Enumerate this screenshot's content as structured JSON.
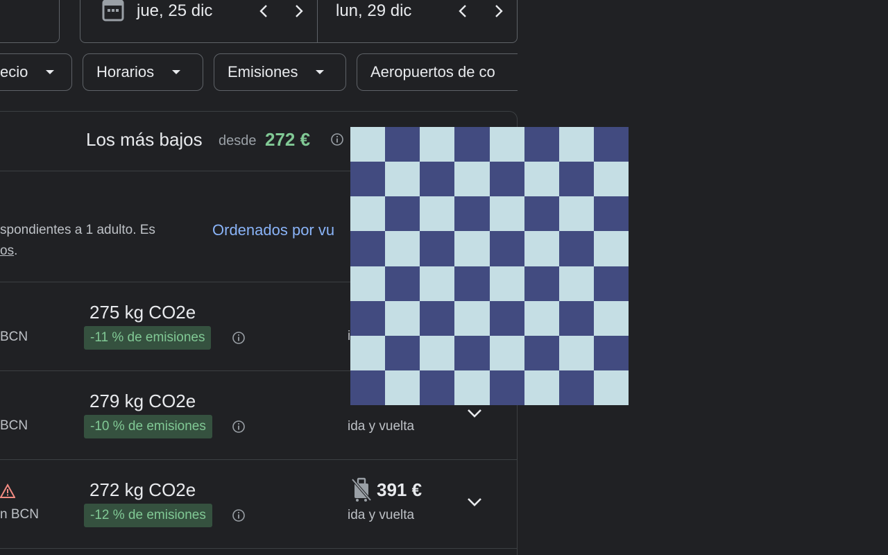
{
  "dates": {
    "depart": "jue, 25 dic",
    "return": "lun, 29 dic"
  },
  "filters": [
    {
      "label": "ecio"
    },
    {
      "label": "Horarios"
    },
    {
      "label": "Emisiones"
    },
    {
      "label": "Aeropuertos de co"
    }
  ],
  "lowest": {
    "title": "Los más bajos",
    "from": "desde",
    "price": "272 €"
  },
  "notes": {
    "line1": "spondientes a 1 adulto. Es",
    "line2_link": "os",
    "line2_tail": ".",
    "sorted": "Ordenados por vu"
  },
  "flights": [
    {
      "airport": "BCN",
      "co2": "275 kg CO2e",
      "badge": "-11 % de emisiones",
      "price": "",
      "trip": "",
      "partial": "i"
    },
    {
      "airport": "BCN",
      "co2": "279 kg CO2e",
      "badge": "-10 % de emisiones",
      "price": "",
      "trip": "ida y vuelta"
    },
    {
      "airport": "n BCN",
      "co2": "272 kg CO2e",
      "badge": "-12 % de emisiones",
      "price": "391 €",
      "trip": "ida y vuelta"
    }
  ],
  "colors": {
    "background": "#202124",
    "green": "#81c995",
    "badge_bg": "#35513f",
    "link": "#8ab4f8",
    "checker_light": "#c5dee4",
    "checker_dark": "#424b80"
  }
}
